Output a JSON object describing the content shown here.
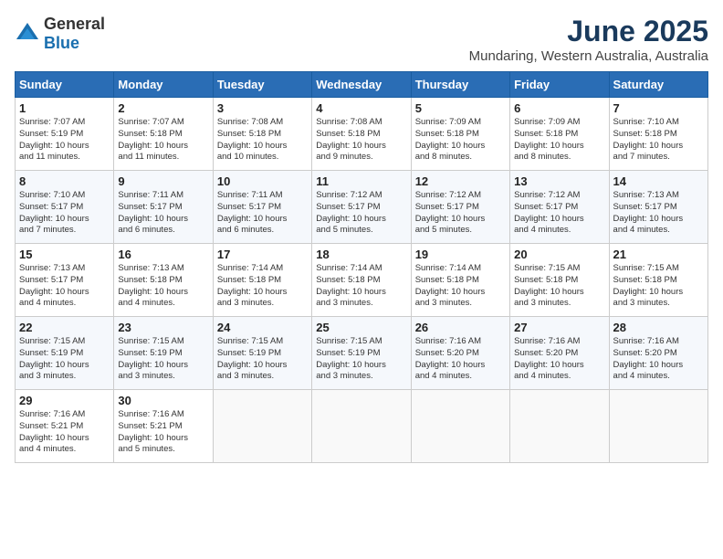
{
  "logo": {
    "general": "General",
    "blue": "Blue"
  },
  "header": {
    "title": "June 2025",
    "subtitle": "Mundaring, Western Australia, Australia"
  },
  "weekdays": [
    "Sunday",
    "Monday",
    "Tuesday",
    "Wednesday",
    "Thursday",
    "Friday",
    "Saturday"
  ],
  "weeks": [
    [
      {
        "day": 1,
        "sunrise": "7:07 AM",
        "sunset": "5:19 PM",
        "daylight": "10 hours and 11 minutes."
      },
      {
        "day": 2,
        "sunrise": "7:07 AM",
        "sunset": "5:18 PM",
        "daylight": "10 hours and 11 minutes."
      },
      {
        "day": 3,
        "sunrise": "7:08 AM",
        "sunset": "5:18 PM",
        "daylight": "10 hours and 10 minutes."
      },
      {
        "day": 4,
        "sunrise": "7:08 AM",
        "sunset": "5:18 PM",
        "daylight": "10 hours and 9 minutes."
      },
      {
        "day": 5,
        "sunrise": "7:09 AM",
        "sunset": "5:18 PM",
        "daylight": "10 hours and 8 minutes."
      },
      {
        "day": 6,
        "sunrise": "7:09 AM",
        "sunset": "5:18 PM",
        "daylight": "10 hours and 8 minutes."
      },
      {
        "day": 7,
        "sunrise": "7:10 AM",
        "sunset": "5:18 PM",
        "daylight": "10 hours and 7 minutes."
      }
    ],
    [
      {
        "day": 8,
        "sunrise": "7:10 AM",
        "sunset": "5:17 PM",
        "daylight": "10 hours and 7 minutes."
      },
      {
        "day": 9,
        "sunrise": "7:11 AM",
        "sunset": "5:17 PM",
        "daylight": "10 hours and 6 minutes."
      },
      {
        "day": 10,
        "sunrise": "7:11 AM",
        "sunset": "5:17 PM",
        "daylight": "10 hours and 6 minutes."
      },
      {
        "day": 11,
        "sunrise": "7:12 AM",
        "sunset": "5:17 PM",
        "daylight": "10 hours and 5 minutes."
      },
      {
        "day": 12,
        "sunrise": "7:12 AM",
        "sunset": "5:17 PM",
        "daylight": "10 hours and 5 minutes."
      },
      {
        "day": 13,
        "sunrise": "7:12 AM",
        "sunset": "5:17 PM",
        "daylight": "10 hours and 4 minutes."
      },
      {
        "day": 14,
        "sunrise": "7:13 AM",
        "sunset": "5:17 PM",
        "daylight": "10 hours and 4 minutes."
      }
    ],
    [
      {
        "day": 15,
        "sunrise": "7:13 AM",
        "sunset": "5:17 PM",
        "daylight": "10 hours and 4 minutes."
      },
      {
        "day": 16,
        "sunrise": "7:13 AM",
        "sunset": "5:18 PM",
        "daylight": "10 hours and 4 minutes."
      },
      {
        "day": 17,
        "sunrise": "7:14 AM",
        "sunset": "5:18 PM",
        "daylight": "10 hours and 3 minutes."
      },
      {
        "day": 18,
        "sunrise": "7:14 AM",
        "sunset": "5:18 PM",
        "daylight": "10 hours and 3 minutes."
      },
      {
        "day": 19,
        "sunrise": "7:14 AM",
        "sunset": "5:18 PM",
        "daylight": "10 hours and 3 minutes."
      },
      {
        "day": 20,
        "sunrise": "7:15 AM",
        "sunset": "5:18 PM",
        "daylight": "10 hours and 3 minutes."
      },
      {
        "day": 21,
        "sunrise": "7:15 AM",
        "sunset": "5:18 PM",
        "daylight": "10 hours and 3 minutes."
      }
    ],
    [
      {
        "day": 22,
        "sunrise": "7:15 AM",
        "sunset": "5:19 PM",
        "daylight": "10 hours and 3 minutes."
      },
      {
        "day": 23,
        "sunrise": "7:15 AM",
        "sunset": "5:19 PM",
        "daylight": "10 hours and 3 minutes."
      },
      {
        "day": 24,
        "sunrise": "7:15 AM",
        "sunset": "5:19 PM",
        "daylight": "10 hours and 3 minutes."
      },
      {
        "day": 25,
        "sunrise": "7:15 AM",
        "sunset": "5:19 PM",
        "daylight": "10 hours and 3 minutes."
      },
      {
        "day": 26,
        "sunrise": "7:16 AM",
        "sunset": "5:20 PM",
        "daylight": "10 hours and 4 minutes."
      },
      {
        "day": 27,
        "sunrise": "7:16 AM",
        "sunset": "5:20 PM",
        "daylight": "10 hours and 4 minutes."
      },
      {
        "day": 28,
        "sunrise": "7:16 AM",
        "sunset": "5:20 PM",
        "daylight": "10 hours and 4 minutes."
      }
    ],
    [
      {
        "day": 29,
        "sunrise": "7:16 AM",
        "sunset": "5:21 PM",
        "daylight": "10 hours and 4 minutes."
      },
      {
        "day": 30,
        "sunrise": "7:16 AM",
        "sunset": "5:21 PM",
        "daylight": "10 hours and 5 minutes."
      },
      null,
      null,
      null,
      null,
      null
    ]
  ],
  "labels": {
    "sunrise": "Sunrise:",
    "sunset": "Sunset:",
    "daylight": "Daylight:"
  }
}
